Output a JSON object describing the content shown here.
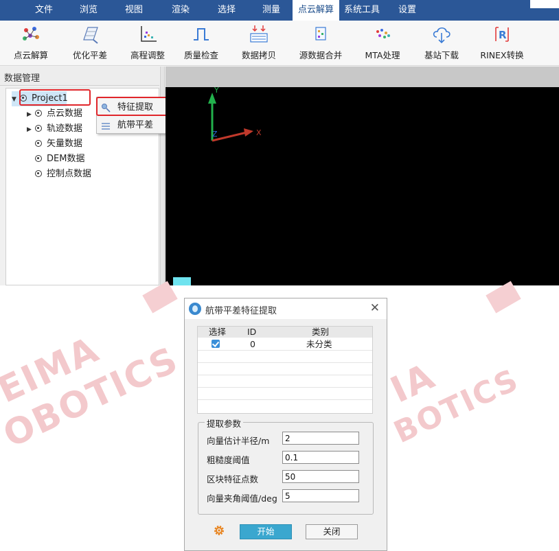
{
  "menu": {
    "items": [
      "文件",
      "浏览",
      "视图",
      "渲染",
      "选择",
      "测量",
      "点云解算",
      "系统工具",
      "设置"
    ],
    "active": "点云解算"
  },
  "toolbar": {
    "tools": [
      {
        "label": "点云解算",
        "icon": "point-cloud-solve-icon"
      },
      {
        "label": "优化平差",
        "icon": "optimize-adjust-icon"
      },
      {
        "label": "高程调整",
        "icon": "elevation-adjust-icon"
      },
      {
        "label": "质量检查",
        "icon": "quality-check-icon"
      },
      {
        "label": "数据拷贝",
        "icon": "data-copy-icon"
      },
      {
        "label": "源数据合并",
        "icon": "merge-data-icon"
      },
      {
        "label": "MTA处理",
        "icon": "mta-process-icon"
      },
      {
        "label": "基站下载",
        "icon": "cloud-download-icon"
      },
      {
        "label": "RINEX转换",
        "icon": "rinex-convert-icon"
      }
    ]
  },
  "panel": {
    "title": "数据管理",
    "tree": {
      "root": "Project1",
      "children": [
        "点云数据",
        "轨迹数据",
        "矢量数据",
        "DEM数据",
        "控制点数据"
      ]
    }
  },
  "context_menu": {
    "items": [
      "特征提取",
      "航带平差"
    ]
  },
  "viewport": {
    "axis_y": "Y",
    "axis_x": "X",
    "axis_z": "Z",
    "colors": {
      "y": "#22b14c",
      "x": "#c0392b",
      "z": "#2a6fdb"
    }
  },
  "watermark": {
    "left_lines": [
      "EIMA",
      "OBOTICS"
    ],
    "right_lines": [
      "IA",
      "BOTICS"
    ]
  },
  "dialog": {
    "title": "航带平差特征提取",
    "close_glyph": "✕",
    "table": {
      "headers": [
        "选择",
        "ID",
        "类别"
      ],
      "rows": [
        {
          "checked": true,
          "id": "0",
          "category": "未分类"
        }
      ]
    },
    "params": {
      "legend": "提取参数",
      "fields": [
        {
          "label": "向量估计半径/m",
          "value": "2"
        },
        {
          "label": "粗糙度阈值",
          "value": "0.1"
        },
        {
          "label": "区块特征点数",
          "value": "50"
        },
        {
          "label": "向量夹角阈值/deg",
          "value": "5"
        }
      ]
    },
    "buttons": {
      "start": "开始",
      "close": "关闭"
    }
  },
  "colors": {
    "menubar": "#2b5797",
    "accent": "#3aa7cf",
    "highlight": "#e0252a"
  }
}
